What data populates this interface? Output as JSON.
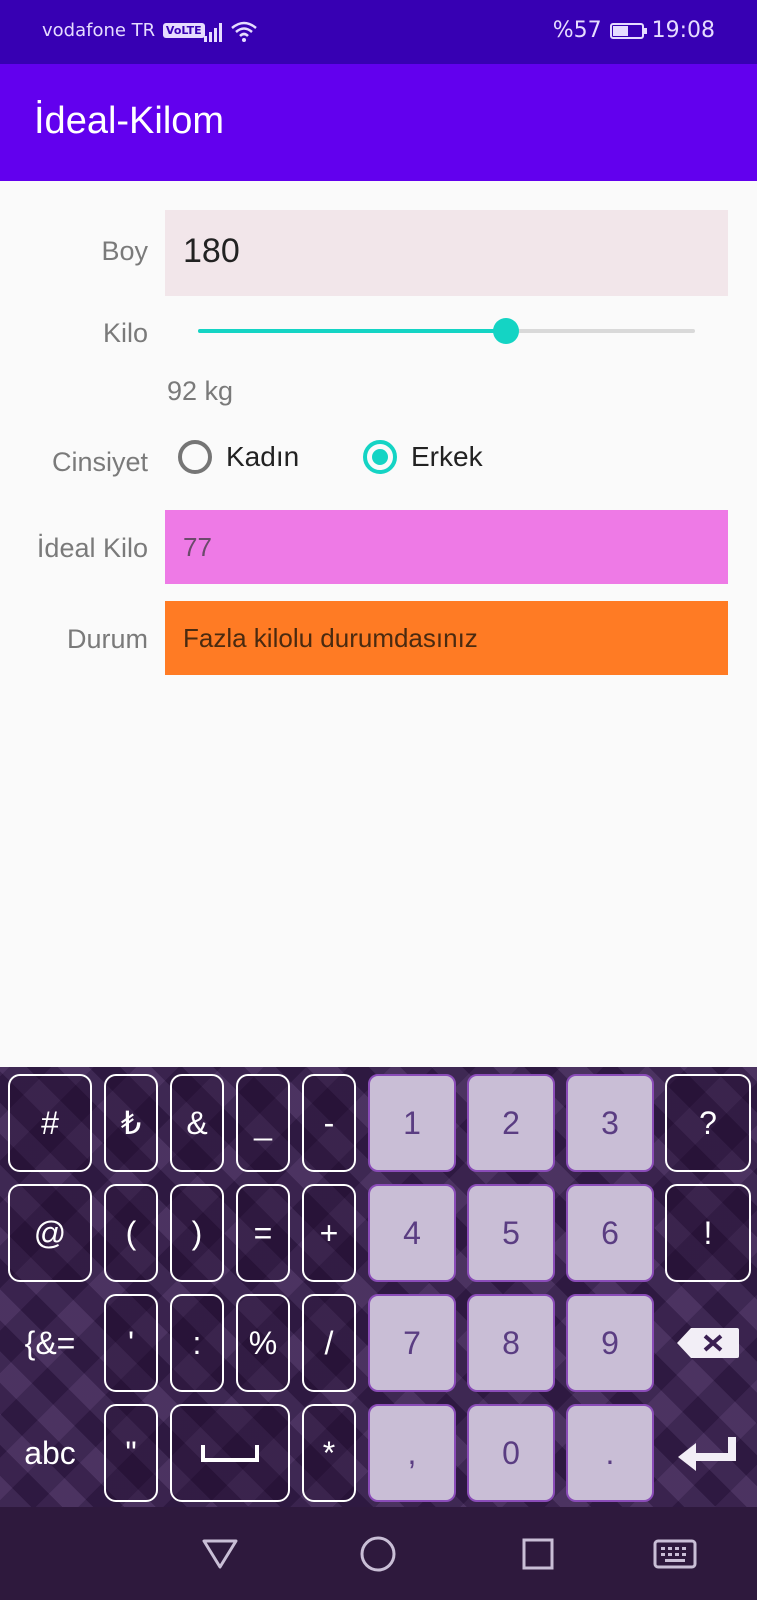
{
  "status_bar": {
    "carrier": "vodafone TR",
    "volte": "VoLTE",
    "battery": "%57",
    "battery_level": 0.57,
    "time": "19:08"
  },
  "app": {
    "title": "İdeal-Kilom"
  },
  "form": {
    "boy_label": "Boy",
    "boy_value": "180",
    "kilo_label": "Kilo",
    "kilo_slider_fraction": 0.62,
    "kilo_value": "92 kg",
    "cinsiyet_label": "Cinsiyet",
    "gender_options": [
      {
        "label": "Kadın",
        "selected": false
      },
      {
        "label": "Erkek",
        "selected": true
      }
    ],
    "ideal_label": "İdeal Kilo",
    "ideal_value": "77",
    "durum_label": "Durum",
    "durum_value": "Fazla kilolu durumdasınız"
  },
  "colors": {
    "app_bar": "#6200ee",
    "status_bar": "#3700b3",
    "accent": "#14d4c4",
    "ideal_bg": "#ee7ae6",
    "durum_bg": "#ff7b24"
  },
  "keyboard": {
    "rows": [
      [
        "#",
        "₺",
        "&",
        "_",
        "-",
        "1",
        "2",
        "3",
        "?"
      ],
      [
        "@",
        "(",
        ")",
        "=",
        "+",
        "4",
        "5",
        "6",
        "!"
      ],
      [
        "{&=",
        "'",
        ":",
        "%",
        "/",
        "7",
        "8",
        "9",
        "backspace-icon"
      ],
      [
        "abc",
        "\"",
        "space-icon",
        "*",
        ",",
        "0",
        ".",
        "enter-icon"
      ]
    ]
  },
  "nav_bar": {
    "icons": [
      "back-icon",
      "home-icon",
      "recents-icon",
      "keyboard-icon"
    ]
  }
}
